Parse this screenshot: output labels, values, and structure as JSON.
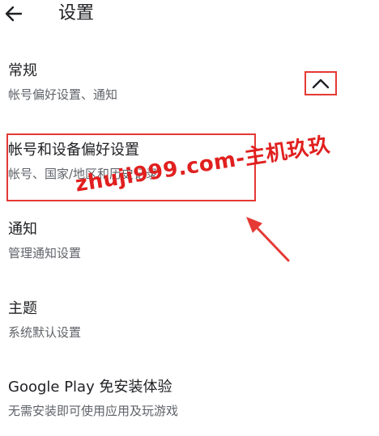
{
  "header": {
    "title": "设置"
  },
  "sections": [
    {
      "title": "常规",
      "subtitle": "帐号偏好设置、通知"
    },
    {
      "title": "帐号和设备偏好设置",
      "subtitle": "帐号、国家/地区和历史记录"
    },
    {
      "title": "通知",
      "subtitle": "管理通知设置"
    },
    {
      "title": "主题",
      "subtitle": "系统默认设置"
    },
    {
      "title": "Google Play 免安装体验",
      "subtitle": "无需安装即可使用应用及玩游戏"
    }
  ],
  "watermark": "zhuji999.com-主机玖玖",
  "colors": {
    "annotation": "#e53935",
    "text": "#202124",
    "subtext": "#5f6368"
  },
  "icons": {
    "back": "arrow-left-icon",
    "collapse": "chevron-up-icon"
  }
}
